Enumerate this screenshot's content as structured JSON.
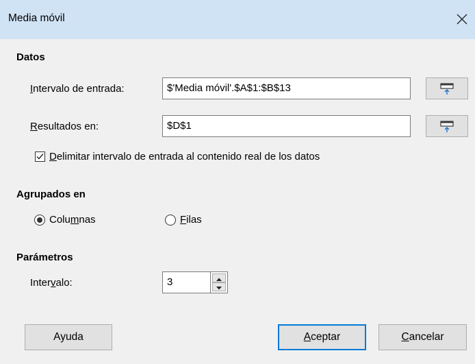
{
  "window": {
    "title": "Media móvil"
  },
  "datos": {
    "heading": "Datos",
    "input_range": {
      "label_pre": "",
      "label_accel": "I",
      "label_post": "ntervalo de entrada:",
      "value": "$'Media móvil'.$A$1:$B$13"
    },
    "results_in": {
      "label_pre": "",
      "label_accel": "R",
      "label_post": "esultados en:",
      "value": "$D$1"
    },
    "limit_checkbox": {
      "label_pre": "",
      "label_accel": "D",
      "label_post": "elimitar intervalo de entrada al contenido real de los datos",
      "checked": true
    }
  },
  "grouped": {
    "heading": "Agrupados en",
    "columns": {
      "label_pre": "Colu",
      "label_accel": "m",
      "label_post": "nas",
      "selected": true
    },
    "rows": {
      "label_pre": "",
      "label_accel": "F",
      "label_post": "ilas",
      "selected": false
    }
  },
  "params": {
    "heading": "Parámetros",
    "interval": {
      "label_pre": "Inter",
      "label_accel": "v",
      "label_post": "alo:",
      "value": "3"
    }
  },
  "buttons": {
    "help": "Ayuda",
    "ok": {
      "pre": "",
      "accel": "A",
      "post": "ceptar"
    },
    "cancel": {
      "pre": "",
      "accel": "C",
      "post": "ancelar"
    }
  },
  "icons": {
    "close": "close-icon",
    "shrink": "shrink-icon",
    "spin_up": "arrow-up-icon",
    "spin_down": "arrow-down-icon"
  },
  "colors": {
    "titlebar": "#d0e3f5",
    "dialog_bg": "#f0f0f0",
    "default_button_border": "#0078d7"
  }
}
